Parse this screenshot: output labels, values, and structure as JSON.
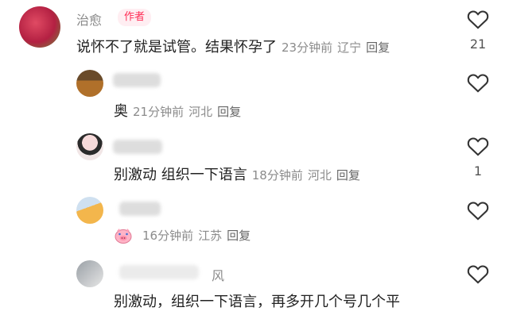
{
  "comments": [
    {
      "user": "治愈",
      "author_tag": "作者",
      "text": "说怀不了就是试管。结果怀孕了",
      "time": "23分钟前",
      "location": "辽宁",
      "reply": "回复",
      "likes": "21"
    },
    {
      "user": "",
      "text": "奥",
      "time": "21分钟前",
      "location": "河北",
      "reply": "回复",
      "likes": ""
    },
    {
      "user": "",
      "text": "别激动 组织一下语言",
      "time": "18分钟前",
      "location": "河北",
      "reply": "回复",
      "likes": "1"
    },
    {
      "user": "",
      "text": "",
      "time": "16分钟前",
      "location": "江苏",
      "reply": "回复",
      "likes": ""
    },
    {
      "user": "风",
      "text": "别激动，组织一下语言，再多开几个号几个平",
      "likes": ""
    }
  ],
  "colors": {
    "author_tag": "#ff2d55",
    "meta": "#8b8b8b",
    "username": "#8a8a8a"
  },
  "icons": {
    "like": "heart-outline-icon",
    "emoji": "pig-face-icon"
  }
}
